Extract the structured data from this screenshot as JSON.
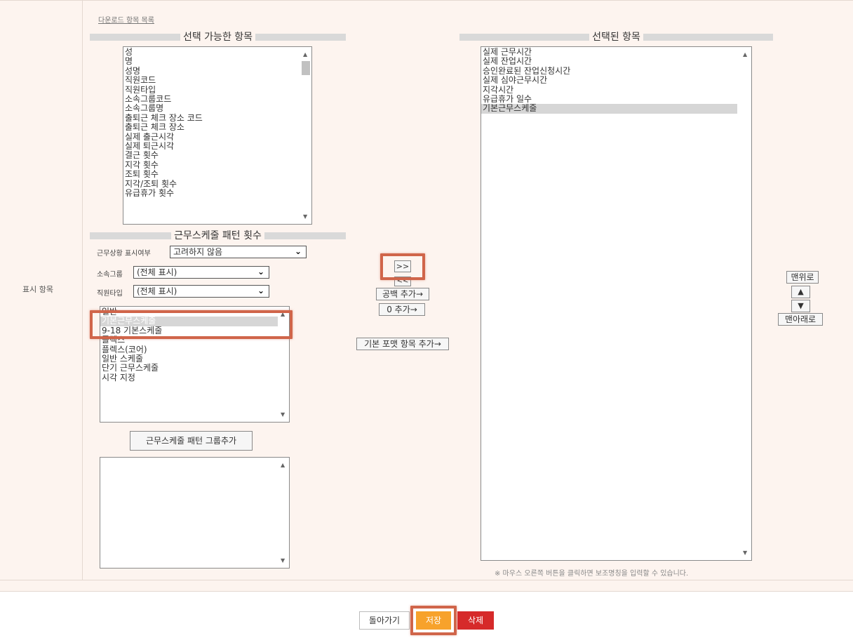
{
  "row_label": "표시 항목",
  "download_link": "다운로드 항목 목록",
  "available": {
    "header": "선택 가능한 항목",
    "items": [
      "성",
      "명",
      "성명",
      "직원코드",
      "직원타입",
      "소속그룹코드",
      "소속그룹명",
      "출퇴근 체크 장소 코드",
      "출퇴근 체크 장소",
      "실제 출근시각",
      "실제 퇴근시각",
      "결근 횟수",
      "지각 횟수",
      "조퇴 횟수",
      "지각/조퇴 횟수",
      "유급휴가 횟수"
    ]
  },
  "pattern_count": {
    "header": "근무스케줄 패턴 횟수",
    "status_label": "근무상황 표시여부",
    "status_value": "고려하지 않음",
    "group_label": "소속그룹",
    "group_value": "(전체 표시)",
    "type_label": "직원타입",
    "type_value": "(전체 표시)",
    "patterns": [
      "일반",
      "기본근무스케줄",
      "9-18 기본스케줄",
      "플렉스",
      "플렉스(코어)",
      "일반 스케줄",
      "단기 근무스케줄",
      "시각 지정"
    ],
    "add_group_button": "근무스케줄 패턴 그룹추가"
  },
  "transfer": {
    "add_label": ">>",
    "remove_label": "<<",
    "blank_label": "공백 추가→",
    "zero_label": "0 추가→",
    "basic_format_label": "기본 포맷 항목 추가→"
  },
  "selected": {
    "header": "선택된 항목",
    "items": [
      "실제 근무시간",
      "실제 잔업시간",
      "승인완료된 잔업신청시간",
      "실제 심야근무시간",
      "지각시간",
      "유급휴가 일수",
      "기본근무스케줄"
    ],
    "note": "※ 마우스 오른쪽 버튼을 클릭하면 보조명칭을 입력할 수 있습니다."
  },
  "order": {
    "top_label": "맨위로",
    "up_label": "▲",
    "down_label": "▼",
    "bottom_label": "맨아래로"
  },
  "footer": {
    "back_label": "돌아가기",
    "save_label": "저장",
    "delete_label": "삭제"
  },
  "colors": {
    "highlight_box": "#d0654a",
    "save_button": "#f7a22b",
    "delete_button": "#d62a2a",
    "panel_bg": "#fdf4ef"
  }
}
